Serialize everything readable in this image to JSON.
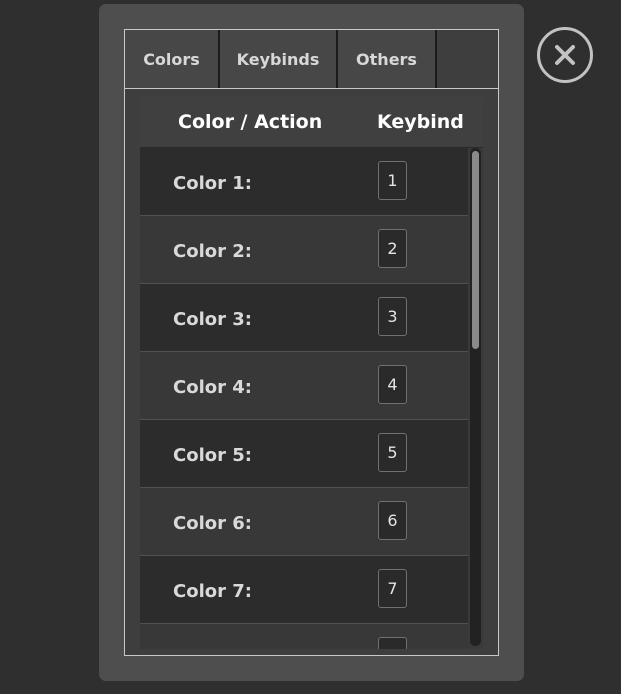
{
  "tabs": [
    {
      "label": "Colors"
    },
    {
      "label": "Keybinds"
    },
    {
      "label": "Others"
    }
  ],
  "close_button": {
    "icon": "close-icon"
  },
  "table": {
    "headers": {
      "color_action": "Color / Action",
      "keybind": "Keybind"
    },
    "rows": [
      {
        "label": "Color 1:",
        "key": "1"
      },
      {
        "label": "Color 2:",
        "key": "2"
      },
      {
        "label": "Color 3:",
        "key": "3"
      },
      {
        "label": "Color 4:",
        "key": "4"
      },
      {
        "label": "Color 5:",
        "key": "5"
      },
      {
        "label": "Color 6:",
        "key": "6"
      },
      {
        "label": "Color 7:",
        "key": "7"
      },
      {
        "label": "",
        "key": ""
      }
    ]
  },
  "colors": {
    "background": "#2f2f2f",
    "modal": "#4e4e4e",
    "header_text": "#ffffff",
    "row_text": "#d9d9d9"
  }
}
